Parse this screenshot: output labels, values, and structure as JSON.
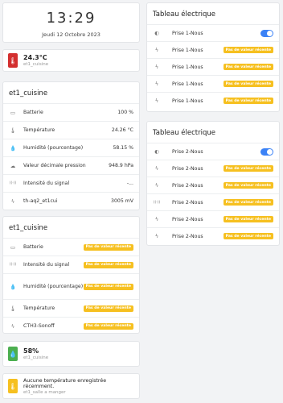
{
  "clock": {
    "time": "13:29",
    "date": "Jeudi 12 Octobre 2023"
  },
  "temp_badge": {
    "value": "24.3°C",
    "entity": "et1_cuisine",
    "icon": "thermometer-icon",
    "color": "#d32f2f"
  },
  "sensors_card": {
    "title": "et1_cuisine",
    "rows": [
      {
        "icon": "battery-icon",
        "label": "Batterie",
        "value": "100 %"
      },
      {
        "icon": "thermometer-icon",
        "label": "Température",
        "value": "24.26 °C"
      },
      {
        "icon": "droplet-icon",
        "label": "Humidité (pourcentage)",
        "value": "58.15 %"
      },
      {
        "icon": "cloud-icon",
        "label": "Valeur décimale pression",
        "value": "948.9 hPa"
      },
      {
        "icon": "signal-icon",
        "label": "Intensité du signal",
        "value": "-..."
      },
      {
        "icon": "bolt-icon",
        "label": "th-aq2_et1cui",
        "value": "3005 mV"
      }
    ]
  },
  "status_card": {
    "title": "et1_cuisine",
    "rows": [
      {
        "icon": "battery-icon",
        "label": "Batterie",
        "badge": "Pas de valeur récente"
      },
      {
        "icon": "signal-icon",
        "label": "Intensité du signal",
        "badge": "Pas de valeur récente"
      },
      {
        "icon": "droplet-icon",
        "label": "Humidité (pourcentage)",
        "badge": "Pas de valeur récente"
      },
      {
        "icon": "thermometer-icon",
        "label": "Température",
        "badge": "Pas de valeur récente"
      },
      {
        "icon": "bolt-icon",
        "label": "CTH3-Sonoff",
        "badge": "Pas de valeur récente"
      }
    ]
  },
  "humidity_badge": {
    "value": "58%",
    "entity": "et1_cuisine",
    "icon": "droplet-icon",
    "color": "#4caf50"
  },
  "warning_badge": {
    "value": "Aucune température enregistrée récemment.",
    "entity": "et1_salle a manger",
    "icon": "thermometer-icon",
    "color": "#f6c020"
  },
  "panel1": {
    "title": "Tableau électrique",
    "rows": [
      {
        "icon": "plug-icon",
        "label": "Prise 1-Nous",
        "toggle": true
      },
      {
        "icon": "bolt-icon",
        "label": "Prise 1-Nous",
        "badge": "Pas de valeur récente"
      },
      {
        "icon": "bolt-icon",
        "label": "Prise 1-Nous",
        "badge": "Pas de valeur récente"
      },
      {
        "icon": "bolt-icon",
        "label": "Prise 1-Nous",
        "badge": "Pas de valeur récente"
      },
      {
        "icon": "bolt-icon",
        "label": "Prise 1-Nous",
        "badge": "Pas de valeur récente"
      }
    ]
  },
  "panel2": {
    "title": "Tableau électrique",
    "rows": [
      {
        "icon": "plug-icon",
        "label": "Prise 2-Nous",
        "toggle": true
      },
      {
        "icon": "bolt-icon",
        "label": "Prise 2-Nous",
        "badge": "Pas de valeur récente"
      },
      {
        "icon": "bolt-icon",
        "label": "Prise 2-Nous",
        "badge": "Pas de valeur récente"
      },
      {
        "icon": "signal-icon",
        "label": "Prise 2-Nous",
        "badge": "Pas de valeur récente"
      },
      {
        "icon": "bolt-icon",
        "label": "Prise 2-Nous",
        "badge": "Pas de valeur récente"
      },
      {
        "icon": "bolt-icon",
        "label": "Prise 2-Nous",
        "badge": "Pas de valeur récente"
      }
    ]
  }
}
